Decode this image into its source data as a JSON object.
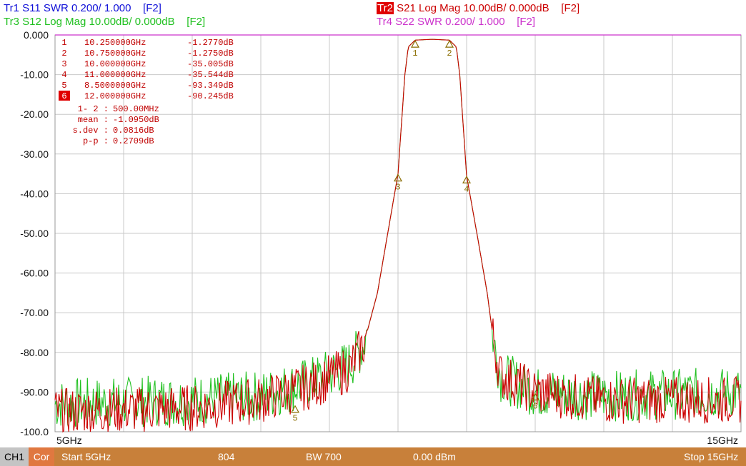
{
  "traces": {
    "tr1": "Tr1 S11 SWR 0.200/ 1.000    [F2]",
    "tr3": "Tr3 S12 Log Mag 10.00dB/ 0.000dB    [F2]",
    "tr2_badge": "Tr2",
    "tr2": " S21 Log Mag 10.00dB/ 0.000dB    [F2]",
    "tr4": "Tr4 S22 SWR 0.200/ 1.000    [F2]"
  },
  "colors": {
    "s11": "#1010d8",
    "s21": "#cc0000",
    "s12": "#20c020",
    "s22": "#cc33cc",
    "status": "#c8803a"
  },
  "markers": [
    {
      "num": "1",
      "freq": "10.250000GHz",
      "value": "-1.2770dB",
      "f": 10.25,
      "y": -1.28
    },
    {
      "num": "2",
      "freq": "10.750000GHz",
      "value": "-1.2750dB",
      "f": 10.75,
      "y": -1.28
    },
    {
      "num": "3",
      "freq": "10.000000GHz",
      "value": "-35.005dB",
      "f": 10.0,
      "y": -35.0
    },
    {
      "num": "4",
      "freq": "11.000000GHz",
      "value": "-35.544dB",
      "f": 11.0,
      "y": -35.5
    },
    {
      "num": "5",
      "freq": "8.5000000GHz",
      "value": "-93.349dB",
      "f": 8.5,
      "y": -93.3
    },
    {
      "num": "6",
      "freq": "12.000000GHz",
      "value": "-90.245dB",
      "f": 12.0,
      "y": -90.2
    }
  ],
  "stats": [
    {
      "label": "1- 2 :",
      "value": "500.00MHz"
    },
    {
      "label": "mean :",
      "value": "-1.0950dB"
    },
    {
      "label": "s.dev :",
      "value": "0.0816dB"
    },
    {
      "label": "p-p :",
      "value": "0.2709dB"
    }
  ],
  "chart_data": {
    "type": "line",
    "x_start_label": "5GHz",
    "x_stop_label": "15GHz",
    "xlim": [
      5,
      15
    ],
    "ylim": [
      -100,
      0
    ],
    "y_ticks": [
      "0.000",
      "-10.00",
      "-20.00",
      "-30.00",
      "-40.00",
      "-50.00",
      "-60.00",
      "-70.00",
      "-80.00",
      "-90.00",
      "-100.0"
    ],
    "grid": true,
    "s21_db": [
      [
        5,
        -95
      ],
      [
        7,
        -94
      ],
      [
        8,
        -92
      ],
      [
        8.8,
        -88
      ],
      [
        9.3,
        -84
      ],
      [
        9.5,
        -78
      ],
      [
        9.7,
        -65
      ],
      [
        9.85,
        -50
      ],
      [
        10,
        -35
      ],
      [
        10.1,
        -10
      ],
      [
        10.15,
        -3
      ],
      [
        10.25,
        -1.3
      ],
      [
        10.5,
        -1.1
      ],
      [
        10.75,
        -1.3
      ],
      [
        10.85,
        -3
      ],
      [
        10.9,
        -10
      ],
      [
        11,
        -35.5
      ],
      [
        11.15,
        -50
      ],
      [
        11.3,
        -65
      ],
      [
        11.4,
        -78
      ],
      [
        11.5,
        -86
      ],
      [
        12,
        -90
      ],
      [
        13,
        -92
      ],
      [
        15,
        -92
      ]
    ],
    "s12_db": [
      [
        5,
        -93
      ],
      [
        7,
        -92
      ],
      [
        8,
        -91
      ],
      [
        8.8,
        -87
      ],
      [
        9.3,
        -83
      ],
      [
        9.5,
        -78
      ],
      [
        9.7,
        -65
      ],
      [
        9.85,
        -50
      ],
      [
        10,
        -35
      ],
      [
        10.1,
        -10
      ],
      [
        10.15,
        -3
      ],
      [
        10.25,
        -1.3
      ],
      [
        10.5,
        -1.1
      ],
      [
        10.75,
        -1.3
      ],
      [
        10.85,
        -3
      ],
      [
        10.9,
        -10
      ],
      [
        11,
        -35.5
      ],
      [
        11.15,
        -50
      ],
      [
        11.3,
        -65
      ],
      [
        11.4,
        -78
      ],
      [
        11.5,
        -86
      ],
      [
        12,
        -90
      ],
      [
        13,
        -91
      ],
      [
        15,
        -90
      ]
    ]
  },
  "status": {
    "ch": "CH1",
    "cor": "Cor",
    "start": "Start 5GHz",
    "points": "804",
    "bw": "BW 700",
    "power": "0.00 dBm",
    "stop": "Stop 15GHz"
  }
}
